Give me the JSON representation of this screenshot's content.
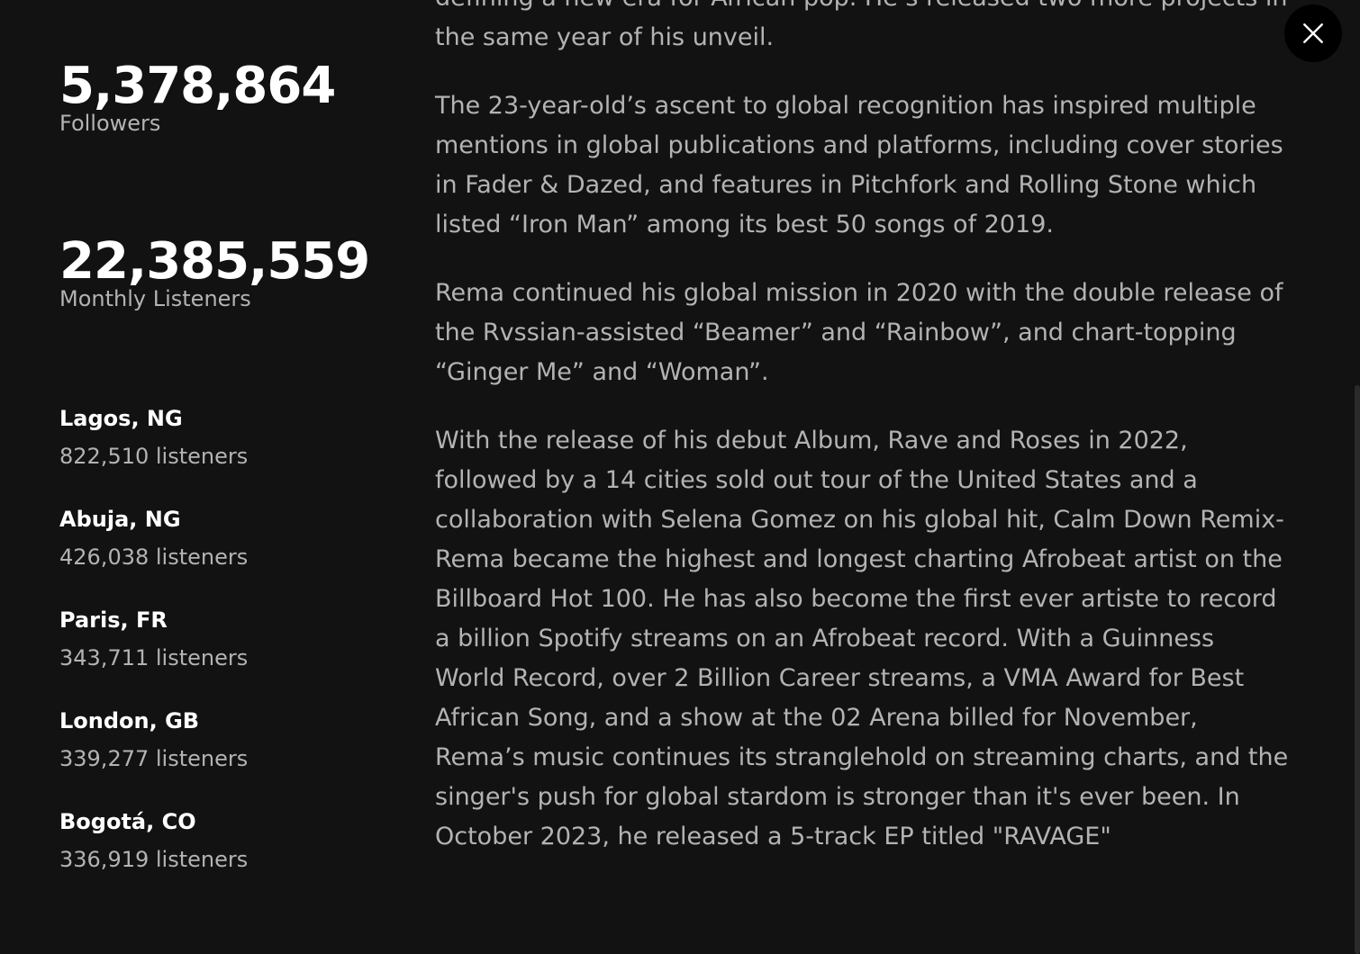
{
  "stats": {
    "followers": {
      "value": "5,378,864",
      "label": "Followers"
    },
    "monthly_listeners": {
      "value": "22,385,559",
      "label": "Monthly Listeners"
    }
  },
  "cities": [
    {
      "name": "Lagos, NG",
      "listeners": "822,510 listeners"
    },
    {
      "name": "Abuja, NG",
      "listeners": "426,038 listeners"
    },
    {
      "name": "Paris, FR",
      "listeners": "343,711 listeners"
    },
    {
      "name": "London, GB",
      "listeners": "339,277 listeners"
    },
    {
      "name": "Bogotá, CO",
      "listeners": "336,919 listeners"
    }
  ],
  "bio": {
    "paragraphs": [
      "defining a new era for African pop. He’s released two more projects in the same year of his unveil.",
      "The 23-year-old’s ascent to global recognition has inspired multiple mentions in global publications and platforms, including cover stories in Fader & Dazed, and features in Pitchfork and Rolling Stone which listed “Iron Man” among its best 50 songs of 2019.",
      "Rema continued his global mission in 2020 with the double release of the Rvssian-assisted “Beamer” and “Rainbow”, and chart-topping “Ginger Me” and “Woman”.",
      "With the release of his debut Album, Rave and Roses in 2022, followed by a 14 cities sold out tour of the United States and a collaboration with Selena Gomez on his global hit, Calm Down Remix- Rema became the highest and longest charting Afrobeat artist on the Billboard Hot 100. He has also become the first ever artiste to record a billion Spotify streams on an Afrobeat record. With a Guinness World Record, over 2 Billion Career streams, a VMA Award for Best African Song, and a show at the 02 Arena billed for November, Rema’s music continues its stranglehold on streaming charts, and the singer's push for global stardom is stronger than it's ever been. In October 2023, he released a 5-track EP titled \"RAVAGE\""
    ]
  },
  "close_button": {
    "icon": "close-icon"
  }
}
